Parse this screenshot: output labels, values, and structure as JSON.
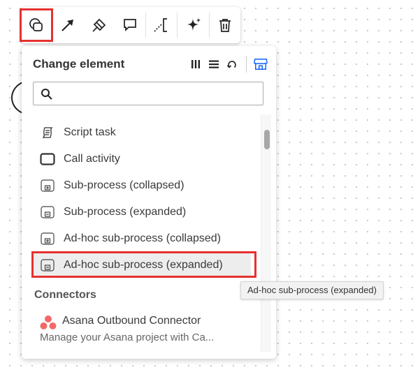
{
  "toolbar": {
    "tools": [
      {
        "name": "change-element-tool",
        "icon": "shapes-icon",
        "active": true
      },
      {
        "name": "connect-tool",
        "icon": "arrow-icon"
      },
      {
        "name": "color-tool",
        "icon": "paint-bucket-icon"
      },
      {
        "name": "comment-tool",
        "icon": "speech-bubble-icon"
      },
      {
        "name": "text-annotation-tool",
        "icon": "annotation-icon"
      },
      {
        "name": "ai-tool",
        "icon": "sparkle-icon"
      },
      {
        "name": "delete-tool",
        "icon": "trash-icon"
      }
    ]
  },
  "popup": {
    "title": "Change element",
    "search": {
      "value": "",
      "placeholder": ""
    },
    "items": [
      {
        "label": "Script task",
        "icon": "script-icon"
      },
      {
        "label": "Call activity",
        "icon": "call-activity-icon"
      },
      {
        "label": "Sub-process (collapsed)",
        "icon": "subprocess-collapsed-icon"
      },
      {
        "label": "Sub-process (expanded)",
        "icon": "subprocess-expanded-icon"
      },
      {
        "label": "Ad-hoc sub-process (collapsed)",
        "icon": "adhoc-collapsed-icon"
      },
      {
        "label": "Ad-hoc sub-process (expanded)",
        "icon": "adhoc-expanded-icon",
        "highlighted": true
      }
    ],
    "section_title": "Connectors",
    "connector": {
      "name": "Asana Outbound Connector",
      "description": "Manage your Asana project with Ca...",
      "icon": "asana-icon",
      "colors": [
        "#f06a6a"
      ]
    }
  },
  "tooltip": {
    "text": "Ad-hoc sub-process (expanded)"
  },
  "colors": {
    "highlight": "#e5312f",
    "accent_blue": "#0f62fe"
  }
}
